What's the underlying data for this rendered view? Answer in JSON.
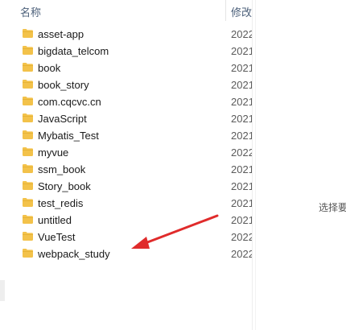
{
  "header": {
    "name_label": "名称",
    "date_label": "修改",
    "sort_icon": "chevron-up-icon"
  },
  "folders": [
    {
      "name": "asset-app",
      "date": "2022"
    },
    {
      "name": "bigdata_telcom",
      "date": "2021"
    },
    {
      "name": "book",
      "date": "2021"
    },
    {
      "name": "book_story",
      "date": "2021"
    },
    {
      "name": "com.cqcvc.cn",
      "date": "2021"
    },
    {
      "name": "JavaScript",
      "date": "2021"
    },
    {
      "name": "Mybatis_Test",
      "date": "2021"
    },
    {
      "name": "myvue",
      "date": "2022"
    },
    {
      "name": "ssm_book",
      "date": "2021"
    },
    {
      "name": "Story_book",
      "date": "2021"
    },
    {
      "name": "test_redis",
      "date": "2021"
    },
    {
      "name": "untitled",
      "date": "2021"
    },
    {
      "name": "VueTest",
      "date": "2022"
    },
    {
      "name": "webpack_study",
      "date": "2022"
    }
  ],
  "preview_pane": {
    "hint": "选择要"
  },
  "colors": {
    "folder": "#f3c24a",
    "folder_dark": "#e0a92a",
    "annotation_arrow": "#e02b2b"
  }
}
